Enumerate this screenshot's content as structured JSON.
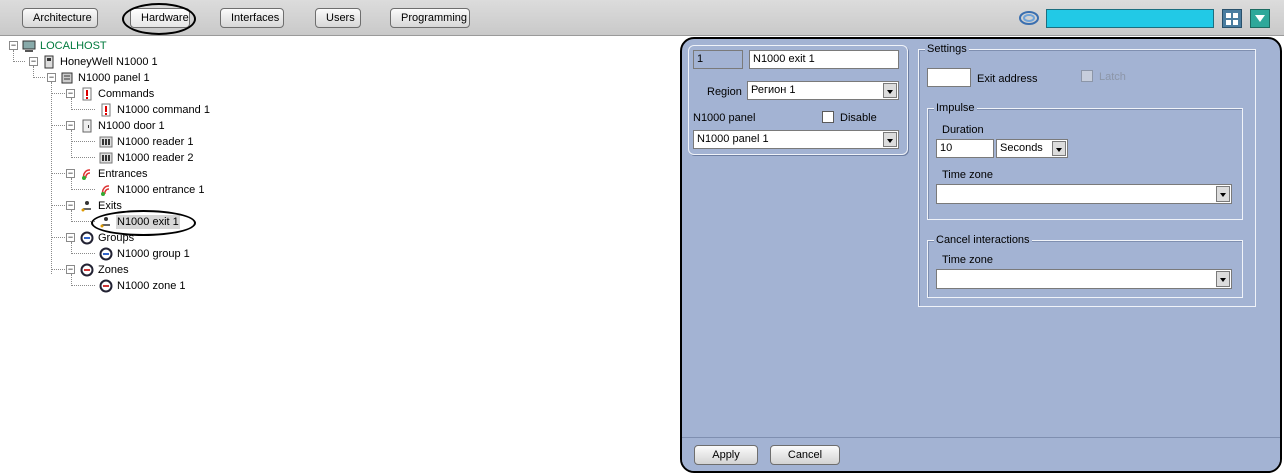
{
  "toolbar": {
    "tabs": [
      {
        "label": "Architecture",
        "active": false
      },
      {
        "label": "Hardware",
        "active": true
      },
      {
        "label": "Interfaces",
        "active": false
      },
      {
        "label": "Users",
        "active": false
      },
      {
        "label": "Programming",
        "active": false
      }
    ],
    "status_color": "#22c9e6",
    "icons": [
      "ring-icon",
      "grid-icon",
      "chevron-down-icon"
    ]
  },
  "tree": {
    "nodes": [
      {
        "label": "LOCALHOST",
        "icon": "computer-icon"
      },
      {
        "label": "HoneyWell N1000 1",
        "icon": "controller-icon"
      },
      {
        "label": "N1000 panel 1",
        "icon": "panel-icon"
      },
      {
        "label": "Commands",
        "icon": "exclamation-icon"
      },
      {
        "label": "N1000 command 1",
        "icon": "exclamation-icon"
      },
      {
        "label": "N1000 door 1",
        "icon": "door-icon"
      },
      {
        "label": "N1000 reader 1",
        "icon": "reader-icon"
      },
      {
        "label": "N1000 reader 2",
        "icon": "reader-icon"
      },
      {
        "label": "Entrances",
        "icon": "entrance-icon"
      },
      {
        "label": "N1000 entrance 1",
        "icon": "entrance-icon"
      },
      {
        "label": "Exits",
        "icon": "exit-icon"
      },
      {
        "label": "N1000 exit 1",
        "icon": "exit-icon",
        "selected": true
      },
      {
        "label": "Groups",
        "icon": "group-icon"
      },
      {
        "label": "N1000 group 1",
        "icon": "group-icon"
      },
      {
        "label": "Zones",
        "icon": "zone-icon"
      },
      {
        "label": "N1000 zone 1",
        "icon": "zone-icon"
      }
    ]
  },
  "object": {
    "id": "1",
    "name": "N1000 exit 1",
    "region_label": "Region",
    "region_value": "Регион 1",
    "panel_label": "N1000 panel",
    "disable_label": "Disable",
    "disable_checked": false,
    "panel_value": "N1000 panel 1"
  },
  "settings": {
    "title": "Settings",
    "exit_address_label": "Exit address",
    "exit_address_value": "",
    "latch_label": "Latch",
    "latch_checked": false,
    "impulse": {
      "title": "Impulse",
      "duration_label": "Duration",
      "duration_value": "10",
      "unit_value": "Seconds",
      "time_zone_label": "Time zone",
      "time_zone_value": ""
    },
    "cancel": {
      "title": "Cancel interactions",
      "time_zone_label": "Time zone",
      "time_zone_value": ""
    }
  },
  "buttons": {
    "apply": "Apply",
    "cancel": "Cancel"
  },
  "colors": {
    "panel_bg": "#a3b3d3",
    "tree_root": "#007a3d"
  }
}
